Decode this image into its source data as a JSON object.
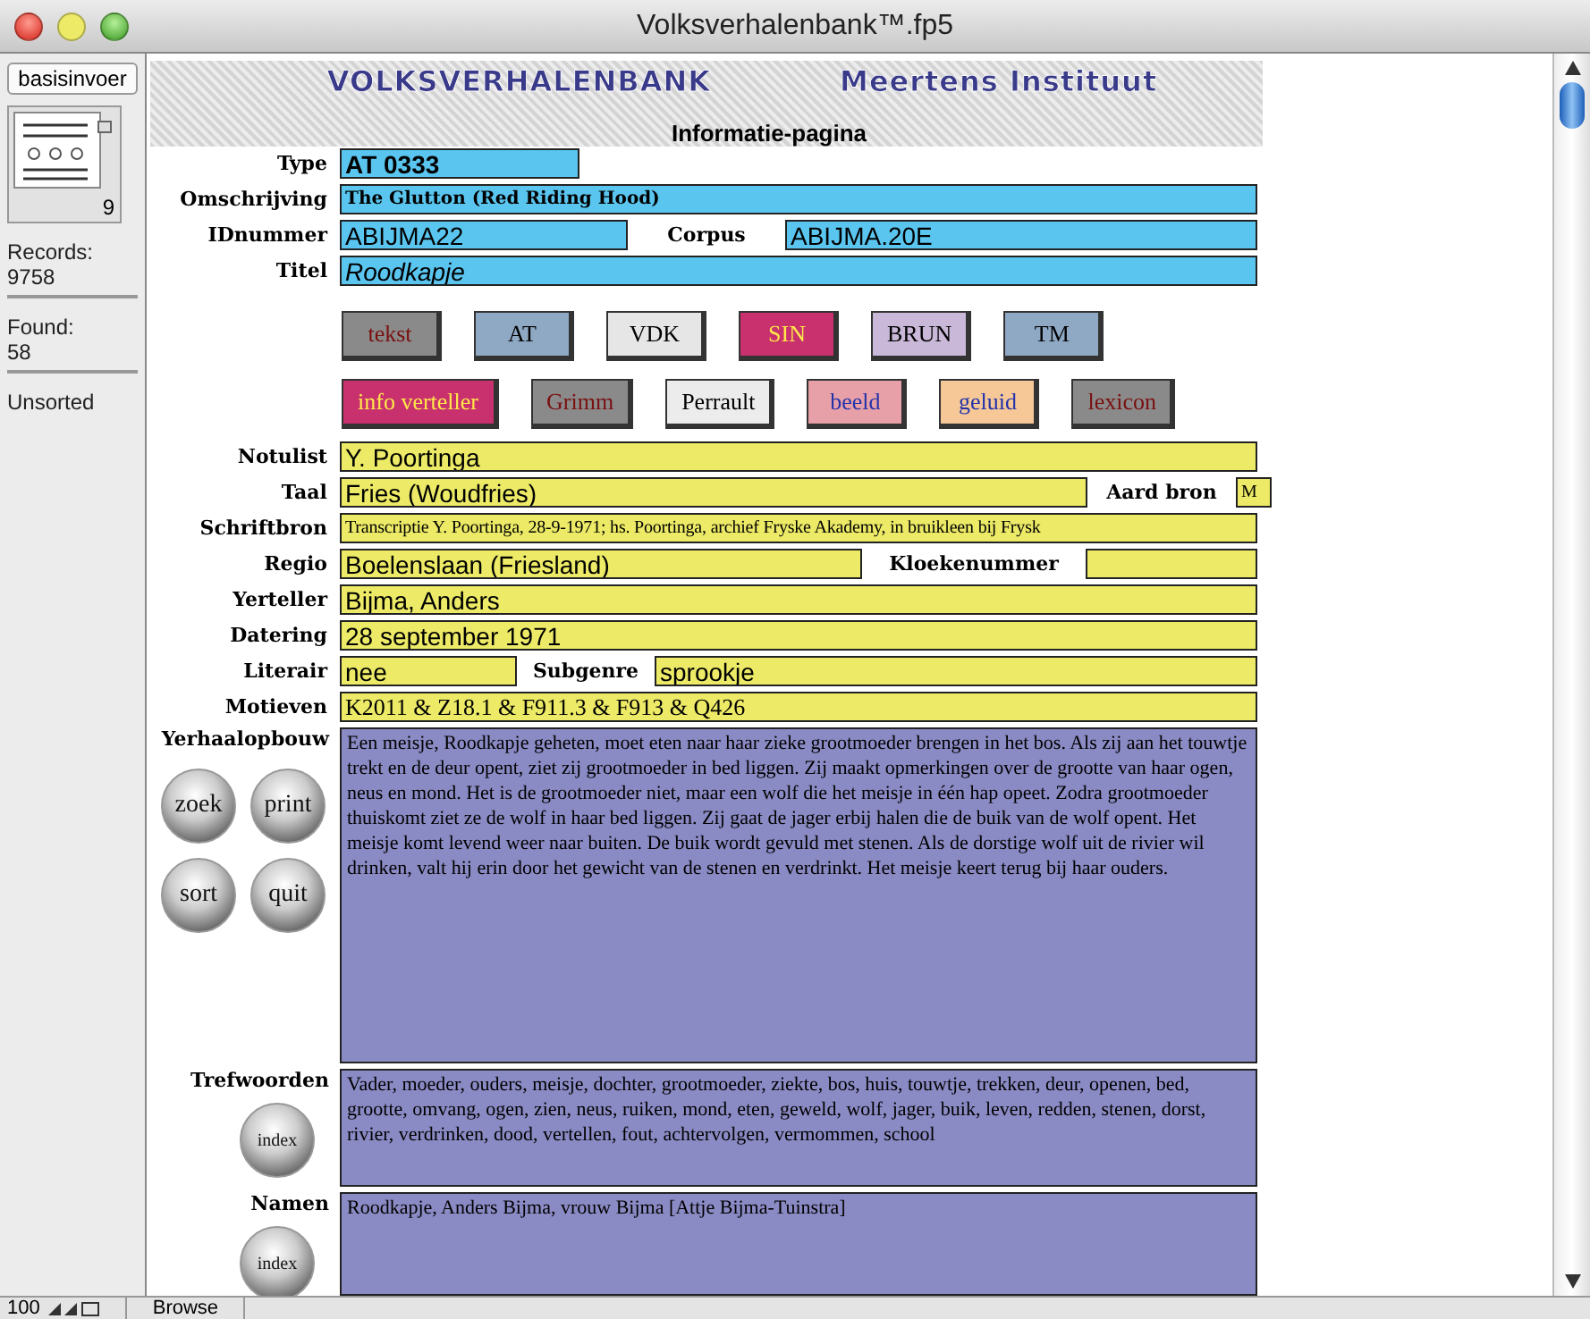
{
  "window": {
    "title": "Volksverhalenbank™.fp5"
  },
  "sidebar": {
    "layout_button": "basisinvoer",
    "page_number": "9",
    "records_label": "Records:",
    "records": "9758",
    "found_label": "Found:",
    "found": "58",
    "sort_status": "Unsorted"
  },
  "header": {
    "banner_left": "VOLKSVERHALENBANK",
    "banner_right": "Meertens Instituut",
    "page_title": "Informatie-pagina"
  },
  "blue_rows": [
    {
      "fields": [
        {
          "label": "Type",
          "value": "AT 0333",
          "kind": "code"
        }
      ]
    },
    {
      "fields": [
        {
          "label": "Omschrijving",
          "value": "The Glutton (Red Riding Hood)",
          "kind": "heading"
        }
      ]
    },
    {
      "fields": [
        {
          "label": "IDnummer",
          "value": "ABIJMA22",
          "kind": "line"
        },
        {
          "label": "Corpus",
          "value": "ABIJMA.20E",
          "kind": "line"
        }
      ]
    },
    {
      "fields": [
        {
          "label": "Titel",
          "value": "Roodkapje",
          "kind": "title"
        }
      ]
    }
  ],
  "button_rows": [
    [
      {
        "label": "tekst",
        "color": "#8a8a8a"
      },
      {
        "label": "AT",
        "color": "#8fa9c4"
      },
      {
        "label": "VDK",
        "color": "#e6e6e6"
      },
      {
        "label": "SIN",
        "color": "#c8306e"
      },
      {
        "label": "BRUN",
        "color": "#c9b8d8"
      },
      {
        "label": "TM",
        "color": "#8fa9c4"
      }
    ],
    [
      {
        "label": "info verteller",
        "color": "#c8306e"
      },
      {
        "label": "Grimm",
        "color": "#8a8a8a"
      },
      {
        "label": "Perrault",
        "color": "#ececec"
      },
      {
        "label": "beeld",
        "color": "#e8a0a8"
      },
      {
        "label": "geluid",
        "color": "#f6c898"
      },
      {
        "label": "lexicon",
        "color": "#8a8a8a"
      }
    ]
  ],
  "yellow_rows": [
    {
      "fields": [
        {
          "label": "Notulist",
          "value": "Y. Poortinga",
          "kind": "line"
        }
      ]
    },
    {
      "fields": [
        {
          "label": "Taal",
          "value": "Fries (Woudfries)",
          "kind": "line"
        },
        {
          "label": "Aard bron",
          "value": "M",
          "kind": "note"
        }
      ]
    },
    {
      "fields": [
        {
          "label": "Schriftbron",
          "value": "Transcriptie Y. Poortinga, 28-9-1971; hs. Poortinga, archief Fryske Akademy, in bruikleen bij Frysk",
          "kind": "note"
        }
      ]
    },
    {
      "fields": [
        {
          "label": "Regio",
          "value": "Boelenslaan (Friesland)",
          "kind": "line"
        },
        {
          "label": "Kloekenummer",
          "kind": "line"
        }
      ]
    },
    {
      "fields": [
        {
          "label": "Yerteller",
          "value": "Bijma, Anders",
          "kind": "line"
        }
      ]
    },
    {
      "fields": [
        {
          "label": "Datering",
          "value": "28 september 1971",
          "kind": "line"
        }
      ]
    },
    {
      "fields": [
        {
          "label": "Literair",
          "value": "nee",
          "kind": "line"
        },
        {
          "label": "Subgenre",
          "value": "sprookje",
          "kind": "line"
        }
      ]
    },
    {
      "fields": [
        {
          "label": "Motieven",
          "value": "K2011 & Z18.1 & F911.3 & F913 & Q426",
          "kind": "serif"
        }
      ]
    }
  ],
  "memos": [
    {
      "label": "Yerhaalopbouw",
      "value": "Een meisje, Roodkapje geheten, moet eten naar haar zieke grootmoeder brengen in het bos. Als zij aan het touwtje trekt en de deur opent, ziet zij grootmoeder in bed liggen. Zij maakt opmerkingen over de grootte van haar ogen, neus en mond. Het is de grootmoeder niet, maar een wolf die het meisje in één hap opeet. Zodra grootmoeder thuiskomt ziet ze de wolf in haar bed liggen. Zij gaat de jager erbij halen die de buik van de wolf opent. Het meisje komt levend weer naar buiten. De buik wordt gevuld met stenen. Als de dorstige wolf uit de rivier wil drinken, valt hij erin door het gewicht van de stenen en verdrinkt. Het meisje keert terug bij haar ouders.",
      "round_buttons": [
        "zoek",
        "print",
        "sort",
        "quit"
      ]
    },
    {
      "label": "Trefwoorden",
      "value": "Vader, moeder, ouders, meisje, dochter, grootmoeder, ziekte, bos, huis, touwtje, trekken, deur, openen, bed, grootte, omvang, ogen, zien, neus, ruiken, mond, eten, geweld, wolf, jager, buik, leven, redden, stenen, dorst, rivier, verdrinken, dood, vertellen, fout, achtervolgen, vermommen, school",
      "round_buttons": [
        "index"
      ]
    },
    {
      "label": "Namen",
      "value": "Roodkapje, Anders Bijma, vrouw Bijma [Attje Bijma-Tuinstra]",
      "round_buttons": [
        "index"
      ]
    }
  ],
  "status_bar": {
    "zoom": "100",
    "mode": "Browse"
  }
}
